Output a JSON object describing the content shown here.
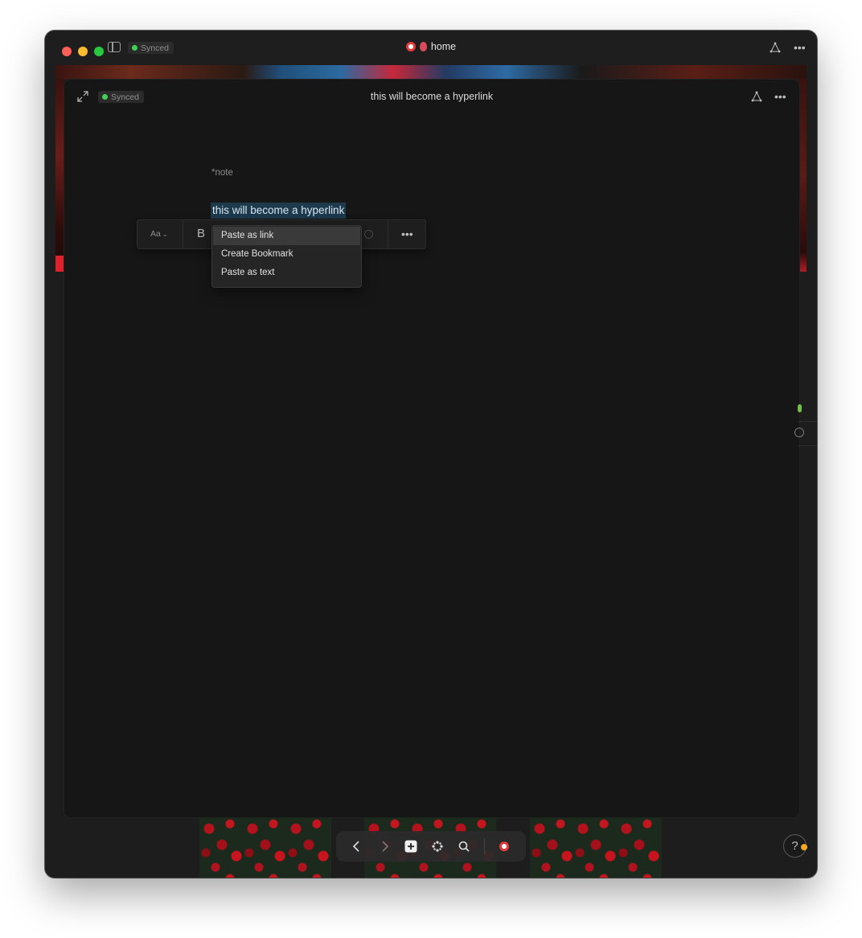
{
  "window": {
    "sync_status": "Synced",
    "title": "home"
  },
  "panel": {
    "sync_status": "Synced",
    "title": "this will become a hyperlink"
  },
  "editor": {
    "note_tag": "*note",
    "selected_text": "this will become a hyperlink"
  },
  "toolbar": {
    "font_label": "Aa",
    "bold_label": "B"
  },
  "paste_menu": {
    "items": [
      {
        "label": "Paste as link",
        "active": true
      },
      {
        "label": "Create Bookmark",
        "active": false
      },
      {
        "label": "Paste as text",
        "active": false
      }
    ]
  },
  "help": {
    "label": "?"
  },
  "colors": {
    "window_bg": "#1d1d1d",
    "panel_bg": "#161616",
    "selection": "#1d3a4d",
    "synced_dot": "#3fd154",
    "badge": "#f5a623"
  },
  "icons": [
    "sidebar-toggle-icon",
    "graph-icon",
    "more-icon",
    "expand-icon",
    "back-icon",
    "forward-icon",
    "new-note-icon",
    "command-icon",
    "search-icon",
    "avatar-icon"
  ]
}
